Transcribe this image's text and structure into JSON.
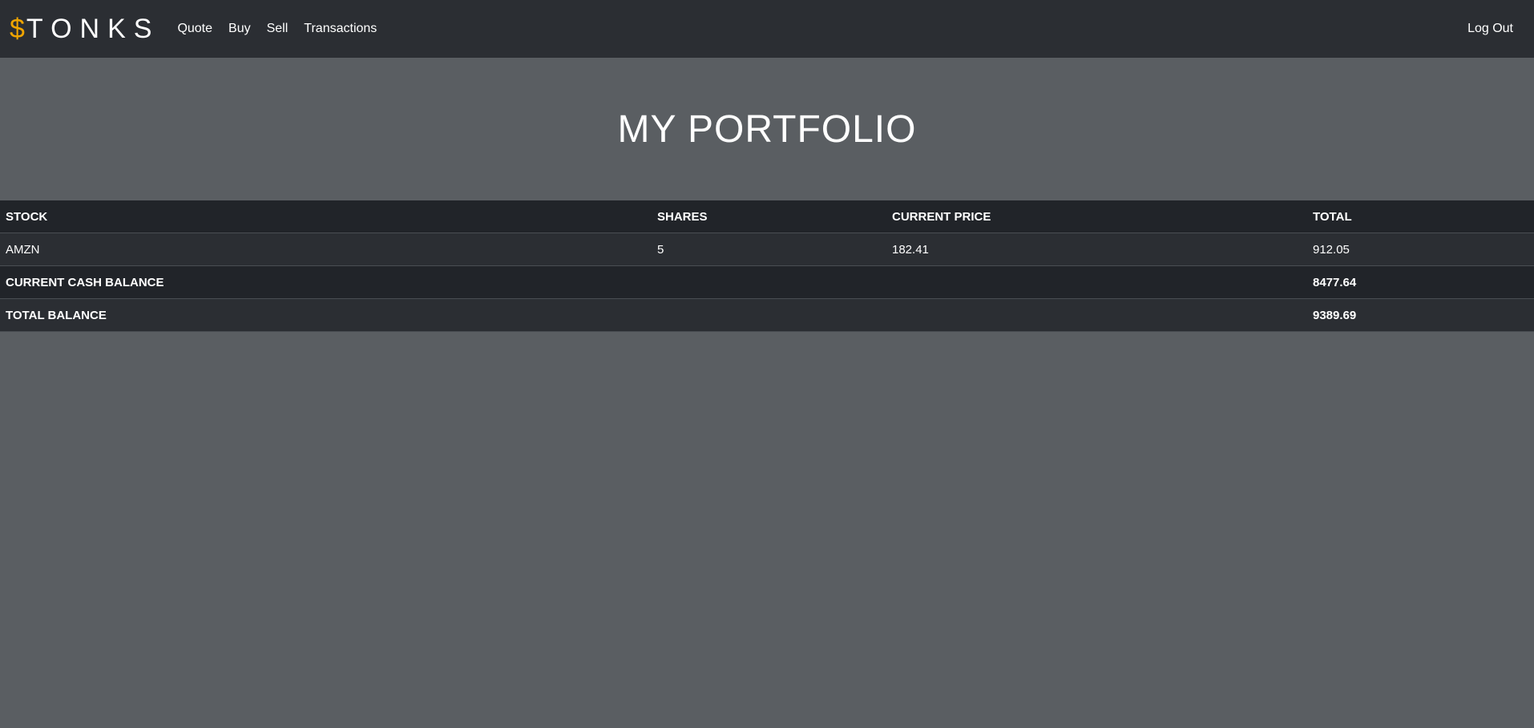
{
  "nav": {
    "brand_symbol": "$",
    "brand_text": "TONKS",
    "links": [
      "Quote",
      "Buy",
      "Sell",
      "Transactions"
    ],
    "logout": "Log Out"
  },
  "page_title": "MY PORTFOLIO",
  "table": {
    "headers": [
      "STOCK",
      "SHARES",
      "CURRENT PRICE",
      "TOTAL"
    ],
    "rows": [
      {
        "stock": "AMZN",
        "shares": "5",
        "price": "182.41",
        "total": "912.05"
      }
    ],
    "cash_label": "CURRENT CASH BALANCE",
    "cash_value": "8477.64",
    "total_label": "TOTAL BALANCE",
    "total_value": "9389.69"
  },
  "colors": {
    "navbar_bg": "#2b2e33",
    "page_bg": "#5a5e62",
    "brand_accent": "#f0a500",
    "table_header_bg": "#212429"
  }
}
